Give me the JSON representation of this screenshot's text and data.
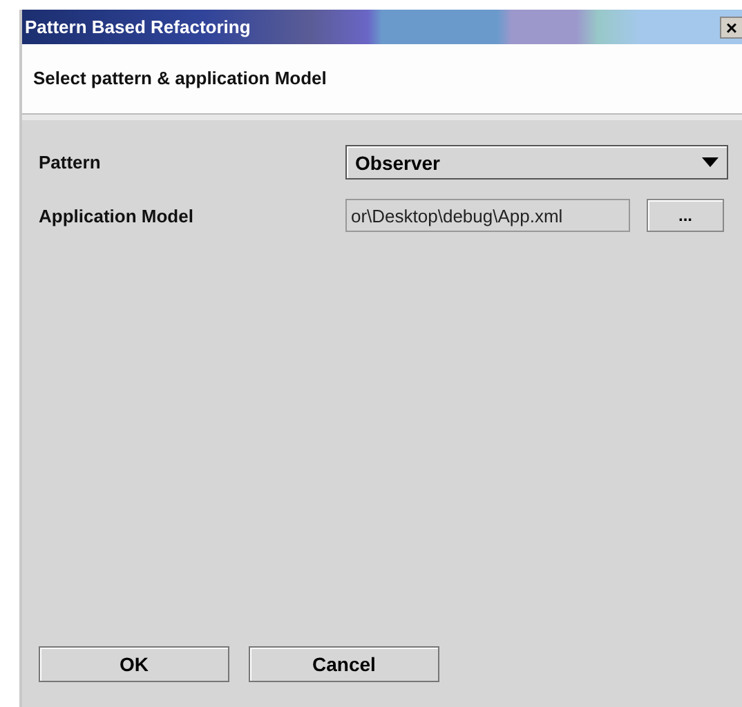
{
  "window": {
    "title": "Pattern Based Refactoring",
    "close": "×"
  },
  "header": "Select pattern & application Model",
  "fields": [
    {
      "kind": "combo",
      "label": "Pattern",
      "value": "Observer"
    },
    {
      "kind": "file",
      "label": "Application Model",
      "value": "or\\Desktop\\debug\\App.xml",
      "button": "..."
    }
  ],
  "buttons": [
    "OK",
    "Cancel"
  ]
}
